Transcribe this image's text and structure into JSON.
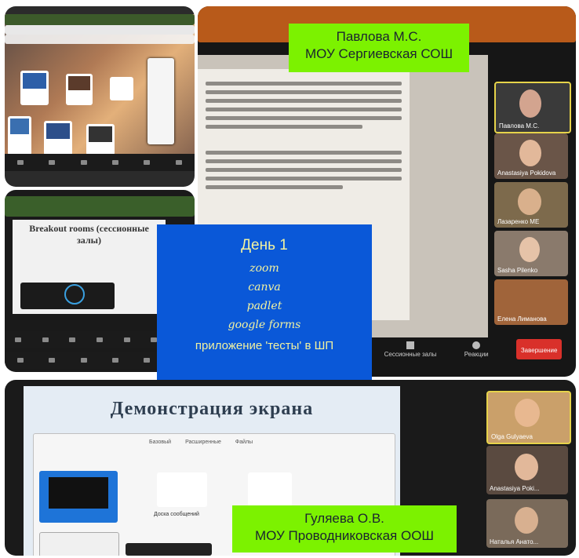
{
  "top_label": {
    "line1": "Павлова М.С.",
    "line2": "МОУ Сергиевская СОШ"
  },
  "bottom_label": {
    "line1": "Гуляева О.В.",
    "line2": "МОУ Проводниковская ООШ"
  },
  "day_card": {
    "title": "День 1",
    "items": [
      "zoom",
      "canva",
      "padlet",
      "google forms"
    ],
    "footer": "приложение 'тесты' в ШП"
  },
  "breakout": {
    "title": "Breakout rooms (сессионные залы)"
  },
  "presentation": {
    "title": "Демонстрация экрана",
    "share_tabs": [
      "Базовый",
      "Расширенные",
      "Файлы"
    ],
    "share_tile_label": "Доска сообщений"
  },
  "zoom_participants_top": [
    "Павлова М.С.",
    "Anastasiya Pokidova",
    "Лазаренко МЕ",
    "Sasha Pilenko",
    "Елена Лиманова"
  ],
  "zoom_participants_bottom": [
    "Olga Gulyaeva",
    "Anastasiya Poki...",
    "Наталья Анато..."
  ],
  "zoom_toolbar": {
    "rooms": "Сессионные залы",
    "reactions": "Реакции",
    "end": "Завершение"
  },
  "colors": {
    "label_green": "#7cf200",
    "card_blue": "#0a58d8",
    "card_text": "#f2f2a0"
  }
}
